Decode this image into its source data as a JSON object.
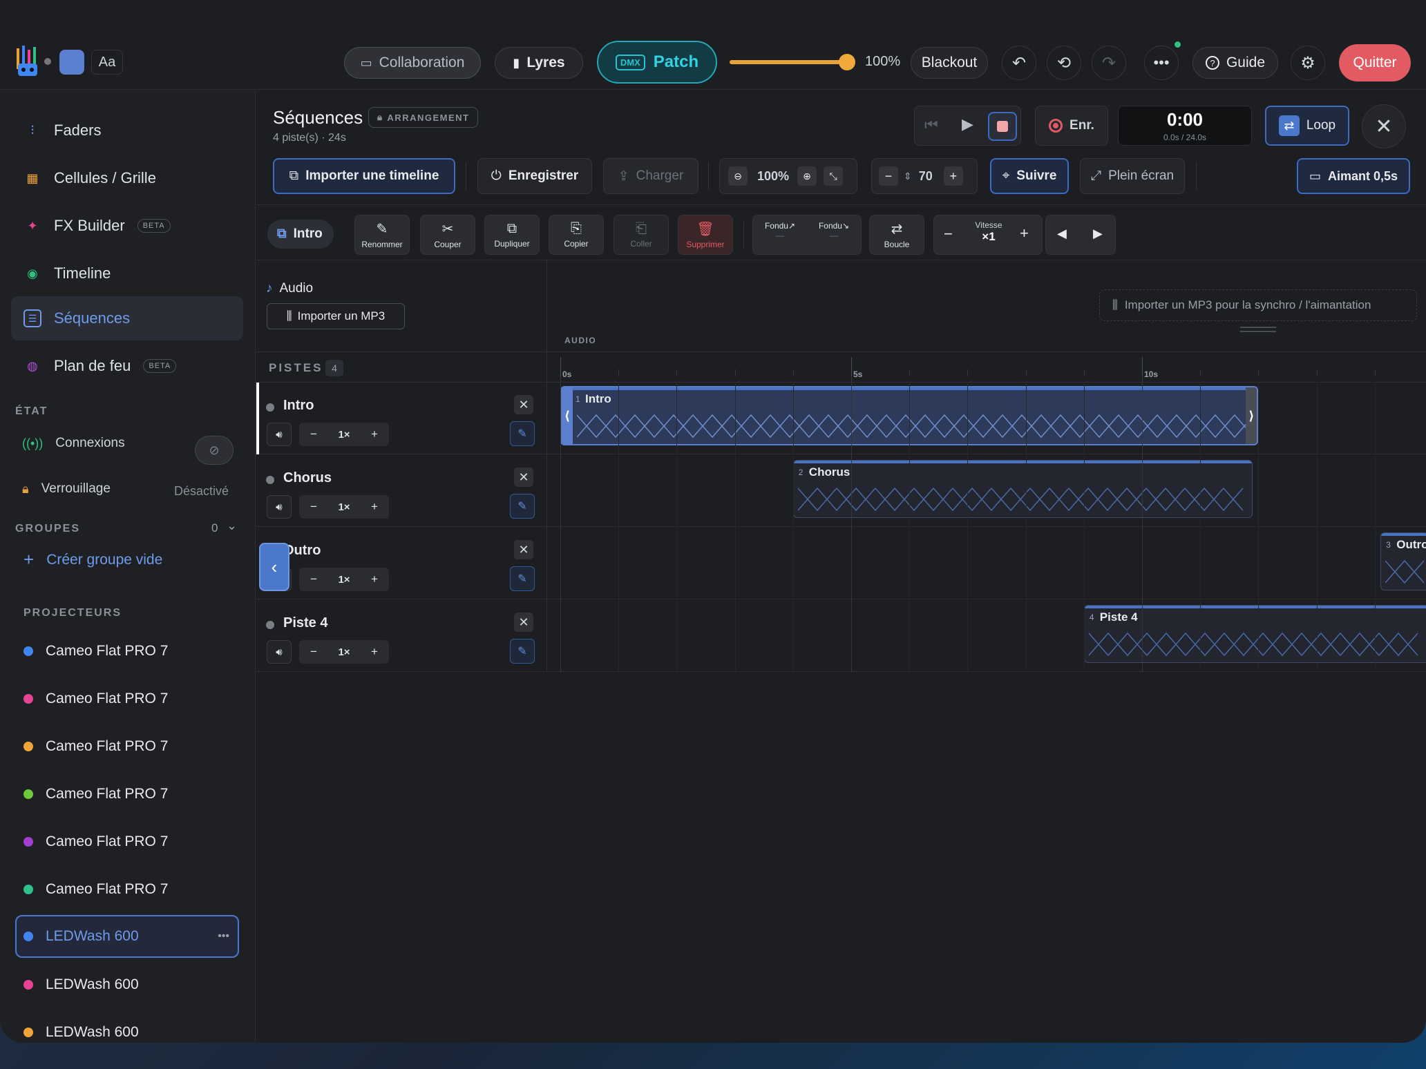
{
  "topbar": {
    "font_label": "Aa",
    "collaboration": "Collaboration",
    "lyres": "Lyres",
    "dmx_badge": "DMX",
    "patch": "Patch",
    "master_pct": "100%",
    "blackout": "Blackout",
    "guide": "Guide",
    "quit": "Quitter",
    "accent": "#21a7b5",
    "quit_color": "#e25b63",
    "master_level": 1.0
  },
  "sidebar": {
    "nav": [
      {
        "label": "Faders",
        "icon": "sliders-icon"
      },
      {
        "label": "Cellules / Grille",
        "icon": "grid-icon"
      },
      {
        "label": "FX Builder",
        "icon": "sparkle-icon",
        "badge": "BETA"
      },
      {
        "label": "Timeline",
        "icon": "timeline-icon"
      },
      {
        "label": "Séquences",
        "icon": "sequence-icon",
        "active": true
      },
      {
        "label": "Plan de feu",
        "icon": "palette-icon",
        "badge": "BETA"
      }
    ],
    "state_title": "ÉTAT",
    "connexions": "Connexions",
    "verrouillage": "Verrouillage",
    "verrouillage_value": "Désactivé",
    "groups_title": "GROUPES",
    "groups_count": "0",
    "create_group": "Créer groupe vide",
    "projectors_title": "PROJECTEURS",
    "projectors": [
      {
        "name": "Cameo Flat PRO 7",
        "color": "#3f86f2"
      },
      {
        "name": "Cameo Flat PRO 7",
        "color": "#e84393"
      },
      {
        "name": "Cameo Flat PRO 7",
        "color": "#f0a43a"
      },
      {
        "name": "Cameo Flat PRO 7",
        "color": "#6cc93a"
      },
      {
        "name": "Cameo Flat PRO 7",
        "color": "#a23ed0"
      },
      {
        "name": "Cameo Flat PRO 7",
        "color": "#2ec28a"
      },
      {
        "name": "LEDWash 600",
        "color": "#3f86f2",
        "active": true
      },
      {
        "name": "LEDWash 600",
        "color": "#e84393"
      },
      {
        "name": "LEDWash 600",
        "color": "#f0a43a"
      }
    ]
  },
  "header": {
    "title": "Séquences",
    "badge": "ARRANGEMENT",
    "subtitle": "4 piste(s) · 24s",
    "rec": "Enr.",
    "time": "0:00",
    "time_sub": "0.0s / 24.0s",
    "loop": "Loop"
  },
  "toolbar": {
    "import_timeline": "Importer une timeline",
    "save": "Enregistrer",
    "load": "Charger",
    "zoom": "100%",
    "height": "70",
    "follow": "Suivre",
    "fullscreen": "Plein écran",
    "magnet": "Aimant 0,5s"
  },
  "edit": {
    "selected": "Intro",
    "rename": "Renommer",
    "cut": "Couper",
    "duplicate": "Dupliquer",
    "copy": "Copier",
    "paste": "Coller",
    "delete": "Supprimer",
    "fade_in": "Fondu↗",
    "fade_out": "Fondu↘",
    "fade_in_val": "—",
    "fade_out_val": "—",
    "loop": "Boucle",
    "speed_label": "Vitesse",
    "speed_value": "×1"
  },
  "audio": {
    "label": "Audio",
    "import": "Importer un MP3",
    "hint": "Importer un MP3 pour la synchro / l'aimantation",
    "tag": "AUDIO"
  },
  "tracks": {
    "title": "PISTES",
    "count": "4",
    "ruler": [
      "0s",
      "5s",
      "10s"
    ],
    "items": [
      {
        "name": "Intro",
        "speed": "1×"
      },
      {
        "name": "Chorus",
        "speed": "1×"
      },
      {
        "name": "Outro",
        "speed": "1×"
      },
      {
        "name": "Piste 4",
        "speed": "1×"
      }
    ],
    "clips": [
      {
        "num": "1",
        "name": "Intro",
        "start": 0.0,
        "end": 12.0
      },
      {
        "num": "2",
        "name": "Chorus",
        "start": 4.0,
        "end": 11.9
      },
      {
        "num": "3",
        "name": "Outro",
        "start": 14.1,
        "end": 15.0
      },
      {
        "num": "4",
        "name": "Piste 4",
        "start": 9.0,
        "end": 15.0
      }
    ]
  }
}
